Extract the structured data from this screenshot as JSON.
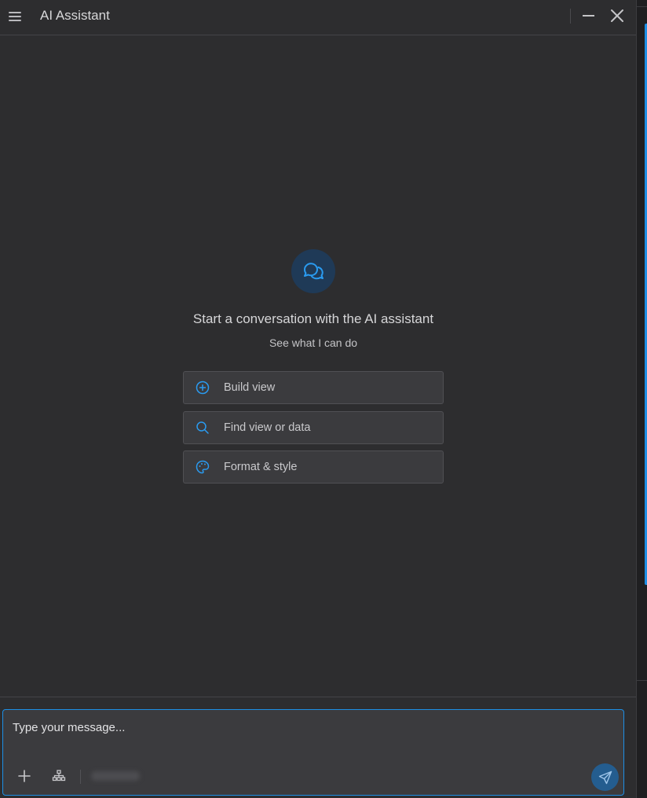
{
  "header": {
    "title": "AI Assistant",
    "menu_icon": "hamburger-icon",
    "minimize_icon": "minimize-icon",
    "close_icon": "close-icon"
  },
  "empty_state": {
    "icon": "chat-bubbles-icon",
    "heading": "Start a conversation with the AI assistant",
    "subheading": "See what I can do"
  },
  "suggestions": [
    {
      "label": "Build view",
      "icon": "plus-circle-icon"
    },
    {
      "label": "Find view or data",
      "icon": "search-icon"
    },
    {
      "label": "Format & style",
      "icon": "palette-icon"
    }
  ],
  "composer": {
    "placeholder": "Type your message...",
    "attach_icon": "plus-icon",
    "context_icon": "hierarchy-icon",
    "send_icon": "send-icon"
  },
  "colors": {
    "background": "#2d2d2f",
    "accent": "#1d8fe5",
    "card": "#3b3b3e",
    "send_button": "#245d8f"
  }
}
